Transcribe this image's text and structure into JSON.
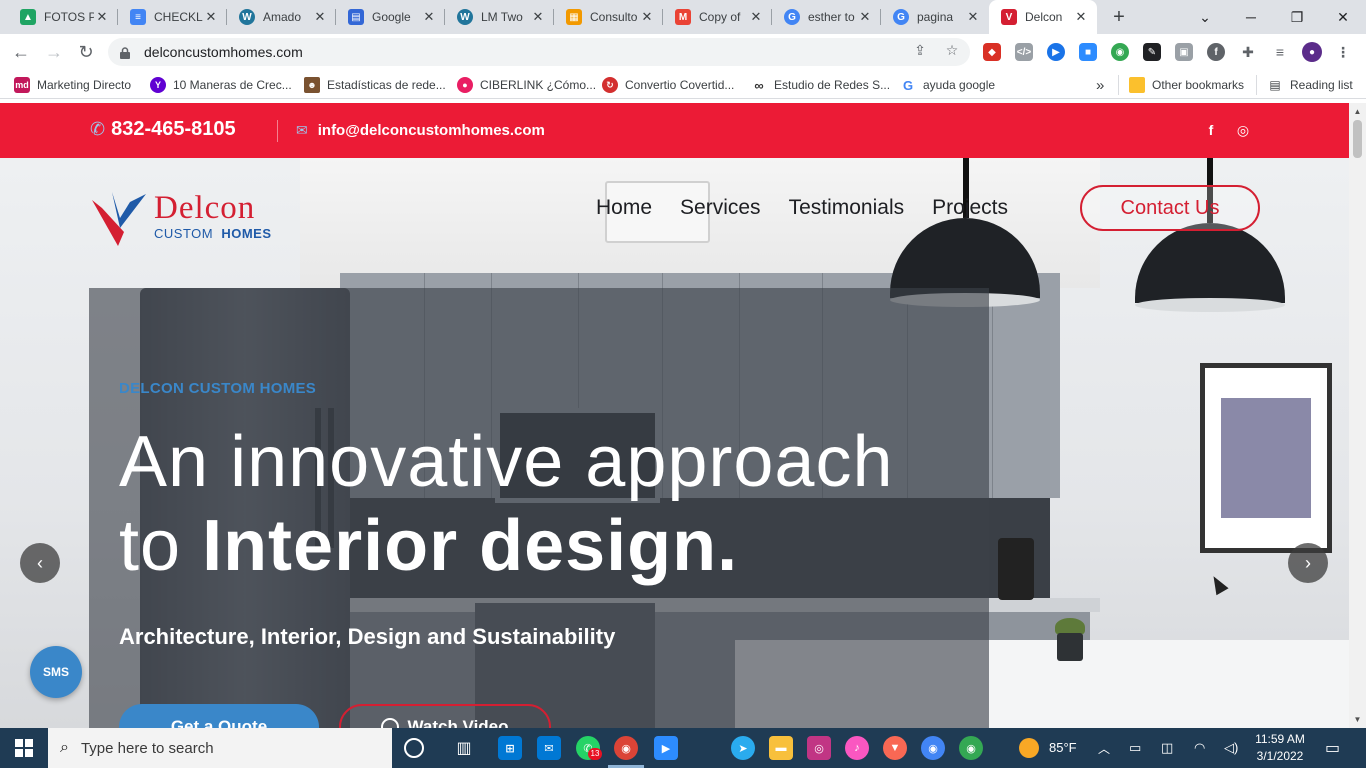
{
  "browser": {
    "tabs": [
      {
        "title": "FOTOS P",
        "icon": "google-drive-icon",
        "color": "#1fa463"
      },
      {
        "title": "CHECKL",
        "icon": "google-docs-icon",
        "color": "#4285f4"
      },
      {
        "title": "Amado",
        "icon": "wordpress-icon",
        "color": "#21759b"
      },
      {
        "title": "Google",
        "icon": "google-forms-icon",
        "color": "#3367d6"
      },
      {
        "title": "LM Two",
        "icon": "wordpress-icon",
        "color": "#21759b"
      },
      {
        "title": "Consulto",
        "icon": "sheets-icon",
        "color": "#f29900"
      },
      {
        "title": "Copy of",
        "icon": "gmail-icon",
        "color": "#ea4335"
      },
      {
        "title": "esther to",
        "icon": "google-icon",
        "color": "#4285f4"
      },
      {
        "title": "pagina",
        "icon": "google-icon",
        "color": "#4285f4"
      },
      {
        "title": "Delcon",
        "icon": "delcon-icon",
        "color": "#d41f32"
      }
    ],
    "url": "delconcustomhomes.com",
    "bookmarks": [
      {
        "label": "Marketing Directo",
        "icon": "md-icon",
        "color": "#c2185b"
      },
      {
        "label": "10 Maneras de Crec...",
        "icon": "yahoo-icon",
        "color": "#6001d2"
      },
      {
        "label": "Estadísticas de rede...",
        "icon": "avatar-icon",
        "color": "#7a5230"
      },
      {
        "label": "CIBERLINK ¿Cómo...",
        "icon": "ciberlink-icon",
        "color": "#e91e63"
      },
      {
        "label": "Convertio Covertid...",
        "icon": "convertio-icon",
        "color": "#d32f2f"
      },
      {
        "label": "Estudio de Redes S...",
        "icon": "infinity-icon",
        "color": "#333333"
      },
      {
        "label": "ayuda google",
        "icon": "google-icon",
        "color": "#4285f4"
      }
    ],
    "bookmarks_more": "»",
    "other_bookmarks": "Other bookmarks",
    "reading_list": "Reading list"
  },
  "site": {
    "topbar": {
      "phone": "832-465-8105",
      "email": "info@delconcustomhomes.com",
      "social": [
        "f",
        "◎"
      ]
    },
    "logo": {
      "brand": "Delcon",
      "sub_a": "CUSTOM",
      "sub_b": "HOMES"
    },
    "nav": [
      "Home",
      "Services",
      "Testimonials",
      "Projects"
    ],
    "contact_button": "Contact Us",
    "hero": {
      "eyebrow": "DELCON CUSTOM HOMES",
      "headline_line1": "An innovative approach",
      "headline_line2_plain": "to ",
      "headline_line2_bold": "Interior design.",
      "subline": "Architecture, Interior, Design and Sustainability",
      "quote_button": "Get a Quote",
      "video_button": "Watch Video"
    },
    "sms_label": "SMS"
  },
  "taskbar": {
    "search_placeholder": "Type here to search",
    "whatsapp_badge": "13",
    "weather": "85°F",
    "time": "11:59 AM",
    "date": "3/1/2022"
  },
  "colors": {
    "brand_red": "#ec1b36",
    "accent_blue": "#3a87c9"
  }
}
